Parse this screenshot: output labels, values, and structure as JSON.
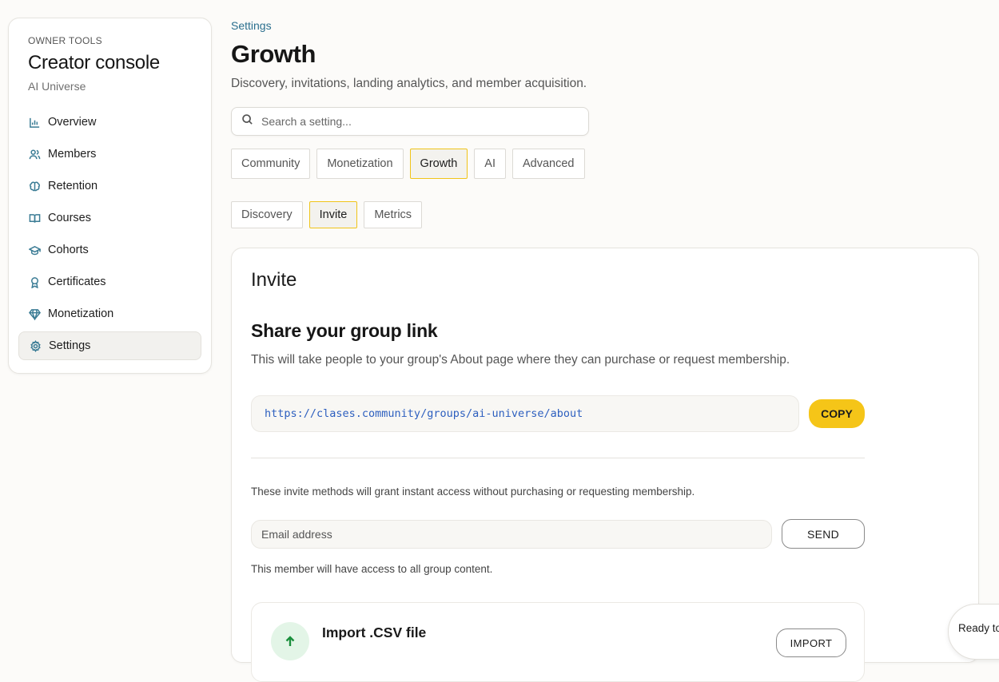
{
  "sidebar": {
    "eyebrow": "OWNER TOOLS",
    "title": "Creator console",
    "subtitle": "AI Universe",
    "items": [
      {
        "label": "Overview",
        "icon": "bar-chart-icon",
        "active": false
      },
      {
        "label": "Members",
        "icon": "users-icon",
        "active": false
      },
      {
        "label": "Retention",
        "icon": "brain-icon",
        "active": false
      },
      {
        "label": "Courses",
        "icon": "book-icon",
        "active": false
      },
      {
        "label": "Cohorts",
        "icon": "graduation-cap-icon",
        "active": false
      },
      {
        "label": "Certificates",
        "icon": "award-icon",
        "active": false
      },
      {
        "label": "Monetization",
        "icon": "gem-icon",
        "active": false
      },
      {
        "label": "Settings",
        "icon": "gear-icon",
        "active": true
      }
    ]
  },
  "header": {
    "breadcrumb": "Settings",
    "title": "Growth",
    "description": "Discovery, invitations, landing analytics, and member acquisition."
  },
  "search": {
    "placeholder": "Search a setting...",
    "value": ""
  },
  "tabs": [
    {
      "label": "Community",
      "active": false
    },
    {
      "label": "Monetization",
      "active": false
    },
    {
      "label": "Growth",
      "active": true
    },
    {
      "label": "AI",
      "active": false
    },
    {
      "label": "Advanced",
      "active": false
    }
  ],
  "subtabs": [
    {
      "label": "Discovery",
      "active": false
    },
    {
      "label": "Invite",
      "active": true
    },
    {
      "label": "Metrics",
      "active": false
    }
  ],
  "card": {
    "title": "Invite",
    "share": {
      "title": "Share your group link",
      "description": "This will take people to your group's About page where they can purchase or request membership.",
      "link": "https://clases.community/groups/ai-universe/about",
      "copy_label": "COPY"
    },
    "invite_note": "These invite methods will grant instant access without purchasing or requesting membership.",
    "email": {
      "placeholder": "Email address",
      "value": "",
      "send_label": "SEND",
      "note": "This member will have access to all group content."
    },
    "import": {
      "title": "Import .CSV file",
      "button_label": "IMPORT",
      "icon": "upload-arrow-icon"
    }
  },
  "toast": {
    "text": "Ready to"
  },
  "colors": {
    "accent": "#f5c518",
    "link": "#2d5fbf",
    "icon": "#3b7c95",
    "breadcrumb": "#2a6f8e"
  }
}
